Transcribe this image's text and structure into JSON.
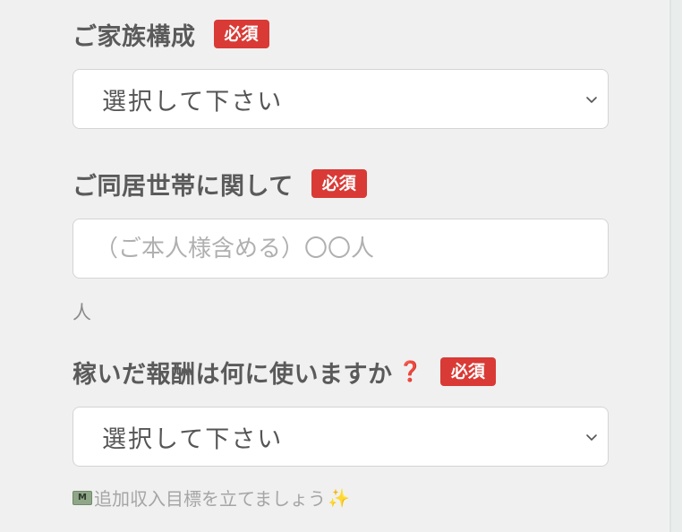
{
  "family": {
    "label": "ご家族構成",
    "required_badge": "必須",
    "select_value": "選択して下さい"
  },
  "household": {
    "label": "ご同居世帯に関して",
    "required_badge": "必須",
    "placeholder": "（ご本人様含める）〇〇人",
    "unit": "人"
  },
  "earnings_use": {
    "label": "稼いだ報酬は何に使いますか",
    "help_icon": "❓",
    "required_badge": "必須",
    "select_value": "選択して下さい",
    "hint_money_icon": "M",
    "hint_text": "追加収入目標を立てましょう",
    "hint_sparkle_icon": "✨"
  },
  "icons": {
    "chevron": "chevron-down-icon",
    "money": "money-icon",
    "sparkle": "sparkle-icon",
    "help": "question-icon"
  },
  "colors": {
    "required_badge_bg": "#d93a35",
    "help_icon": "#d63a3a",
    "field_border": "#d4d4d4",
    "background": "#f0f0f0"
  }
}
